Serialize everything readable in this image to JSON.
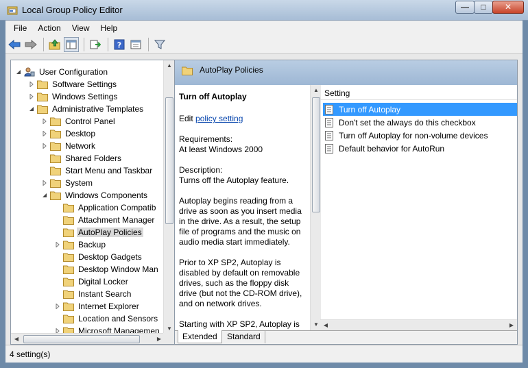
{
  "window": {
    "title": "Local Group Policy Editor",
    "minimize_glyph": "—",
    "maximize_glyph": "□",
    "close_glyph": "✕"
  },
  "menu": [
    "File",
    "Action",
    "View",
    "Help"
  ],
  "toolbar": {
    "buttons": [
      "back-icon",
      "forward-icon",
      "up-folder-icon",
      "show-hide-tree-icon",
      "export-list-icon",
      "help-icon",
      "properties-icon",
      "filter-icon"
    ]
  },
  "tree": {
    "items": [
      {
        "label": "User Configuration",
        "level": 0,
        "expander": "collapse",
        "icon": "user-config-icon"
      },
      {
        "label": "Software Settings",
        "level": 1,
        "expander": "expand",
        "icon": "folder-icon"
      },
      {
        "label": "Windows Settings",
        "level": 1,
        "expander": "expand",
        "icon": "folder-icon"
      },
      {
        "label": "Administrative Templates",
        "level": 1,
        "expander": "collapse",
        "icon": "folder-icon"
      },
      {
        "label": "Control Panel",
        "level": 2,
        "expander": "expand",
        "icon": "folder-icon"
      },
      {
        "label": "Desktop",
        "level": 2,
        "expander": "expand",
        "icon": "folder-icon"
      },
      {
        "label": "Network",
        "level": 2,
        "expander": "expand",
        "icon": "folder-icon"
      },
      {
        "label": "Shared Folders",
        "level": 2,
        "expander": "none",
        "icon": "folder-icon"
      },
      {
        "label": "Start Menu and Taskbar",
        "level": 2,
        "expander": "none",
        "icon": "folder-icon"
      },
      {
        "label": "System",
        "level": 2,
        "expander": "expand",
        "icon": "folder-icon"
      },
      {
        "label": "Windows Components",
        "level": 2,
        "expander": "collapse",
        "icon": "folder-icon"
      },
      {
        "label": "Application Compatib",
        "level": 3,
        "expander": "none",
        "icon": "folder-icon"
      },
      {
        "label": "Attachment Manager",
        "level": 3,
        "expander": "none",
        "icon": "folder-icon"
      },
      {
        "label": "AutoPlay Policies",
        "level": 3,
        "expander": "none",
        "icon": "folder-icon",
        "selected": true
      },
      {
        "label": "Backup",
        "level": 3,
        "expander": "expand",
        "icon": "folder-icon"
      },
      {
        "label": "Desktop Gadgets",
        "level": 3,
        "expander": "none",
        "icon": "folder-icon"
      },
      {
        "label": "Desktop Window Man",
        "level": 3,
        "expander": "none",
        "icon": "folder-icon"
      },
      {
        "label": "Digital Locker",
        "level": 3,
        "expander": "none",
        "icon": "folder-icon"
      },
      {
        "label": "Instant Search",
        "level": 3,
        "expander": "none",
        "icon": "folder-icon"
      },
      {
        "label": "Internet Explorer",
        "level": 3,
        "expander": "expand",
        "icon": "folder-icon"
      },
      {
        "label": "Location and Sensors",
        "level": 3,
        "expander": "none",
        "icon": "folder-icon"
      },
      {
        "label": "Microsoft Managemen",
        "level": 3,
        "expander": "expand",
        "icon": "folder-icon"
      }
    ]
  },
  "header": {
    "title": "AutoPlay Policies"
  },
  "description": {
    "title": "Turn off Autoplay",
    "edit_prefix": "Edit ",
    "edit_link": "policy setting ",
    "requirements_label": "Requirements:",
    "requirements_value": "At least Windows 2000",
    "description_label": "Description:",
    "description_value": "Turns off the Autoplay feature.",
    "para1": "Autoplay begins reading from a drive as soon as you insert media in the drive. As a result, the setup file of programs and the music on audio media start immediately.",
    "para2": "Prior to XP SP2, Autoplay is disabled by default on removable drives, such as the floppy disk drive (but not the CD-ROM drive), and on network drives.",
    "para3": "Starting with XP SP2, Autoplay is"
  },
  "settings": {
    "column_header": "Setting",
    "items": [
      {
        "label": "Turn off Autoplay",
        "selected": true
      },
      {
        "label": "Don't set the always do this checkbox",
        "selected": false
      },
      {
        "label": "Turn off Autoplay for non-volume devices",
        "selected": false
      },
      {
        "label": "Default behavior for AutoRun",
        "selected": false
      }
    ]
  },
  "tabs": [
    "Extended",
    "Standard"
  ],
  "status": {
    "text": "4 setting(s)"
  },
  "colors": {
    "selection": "#3399ff",
    "header_band": "#9db7d4"
  }
}
